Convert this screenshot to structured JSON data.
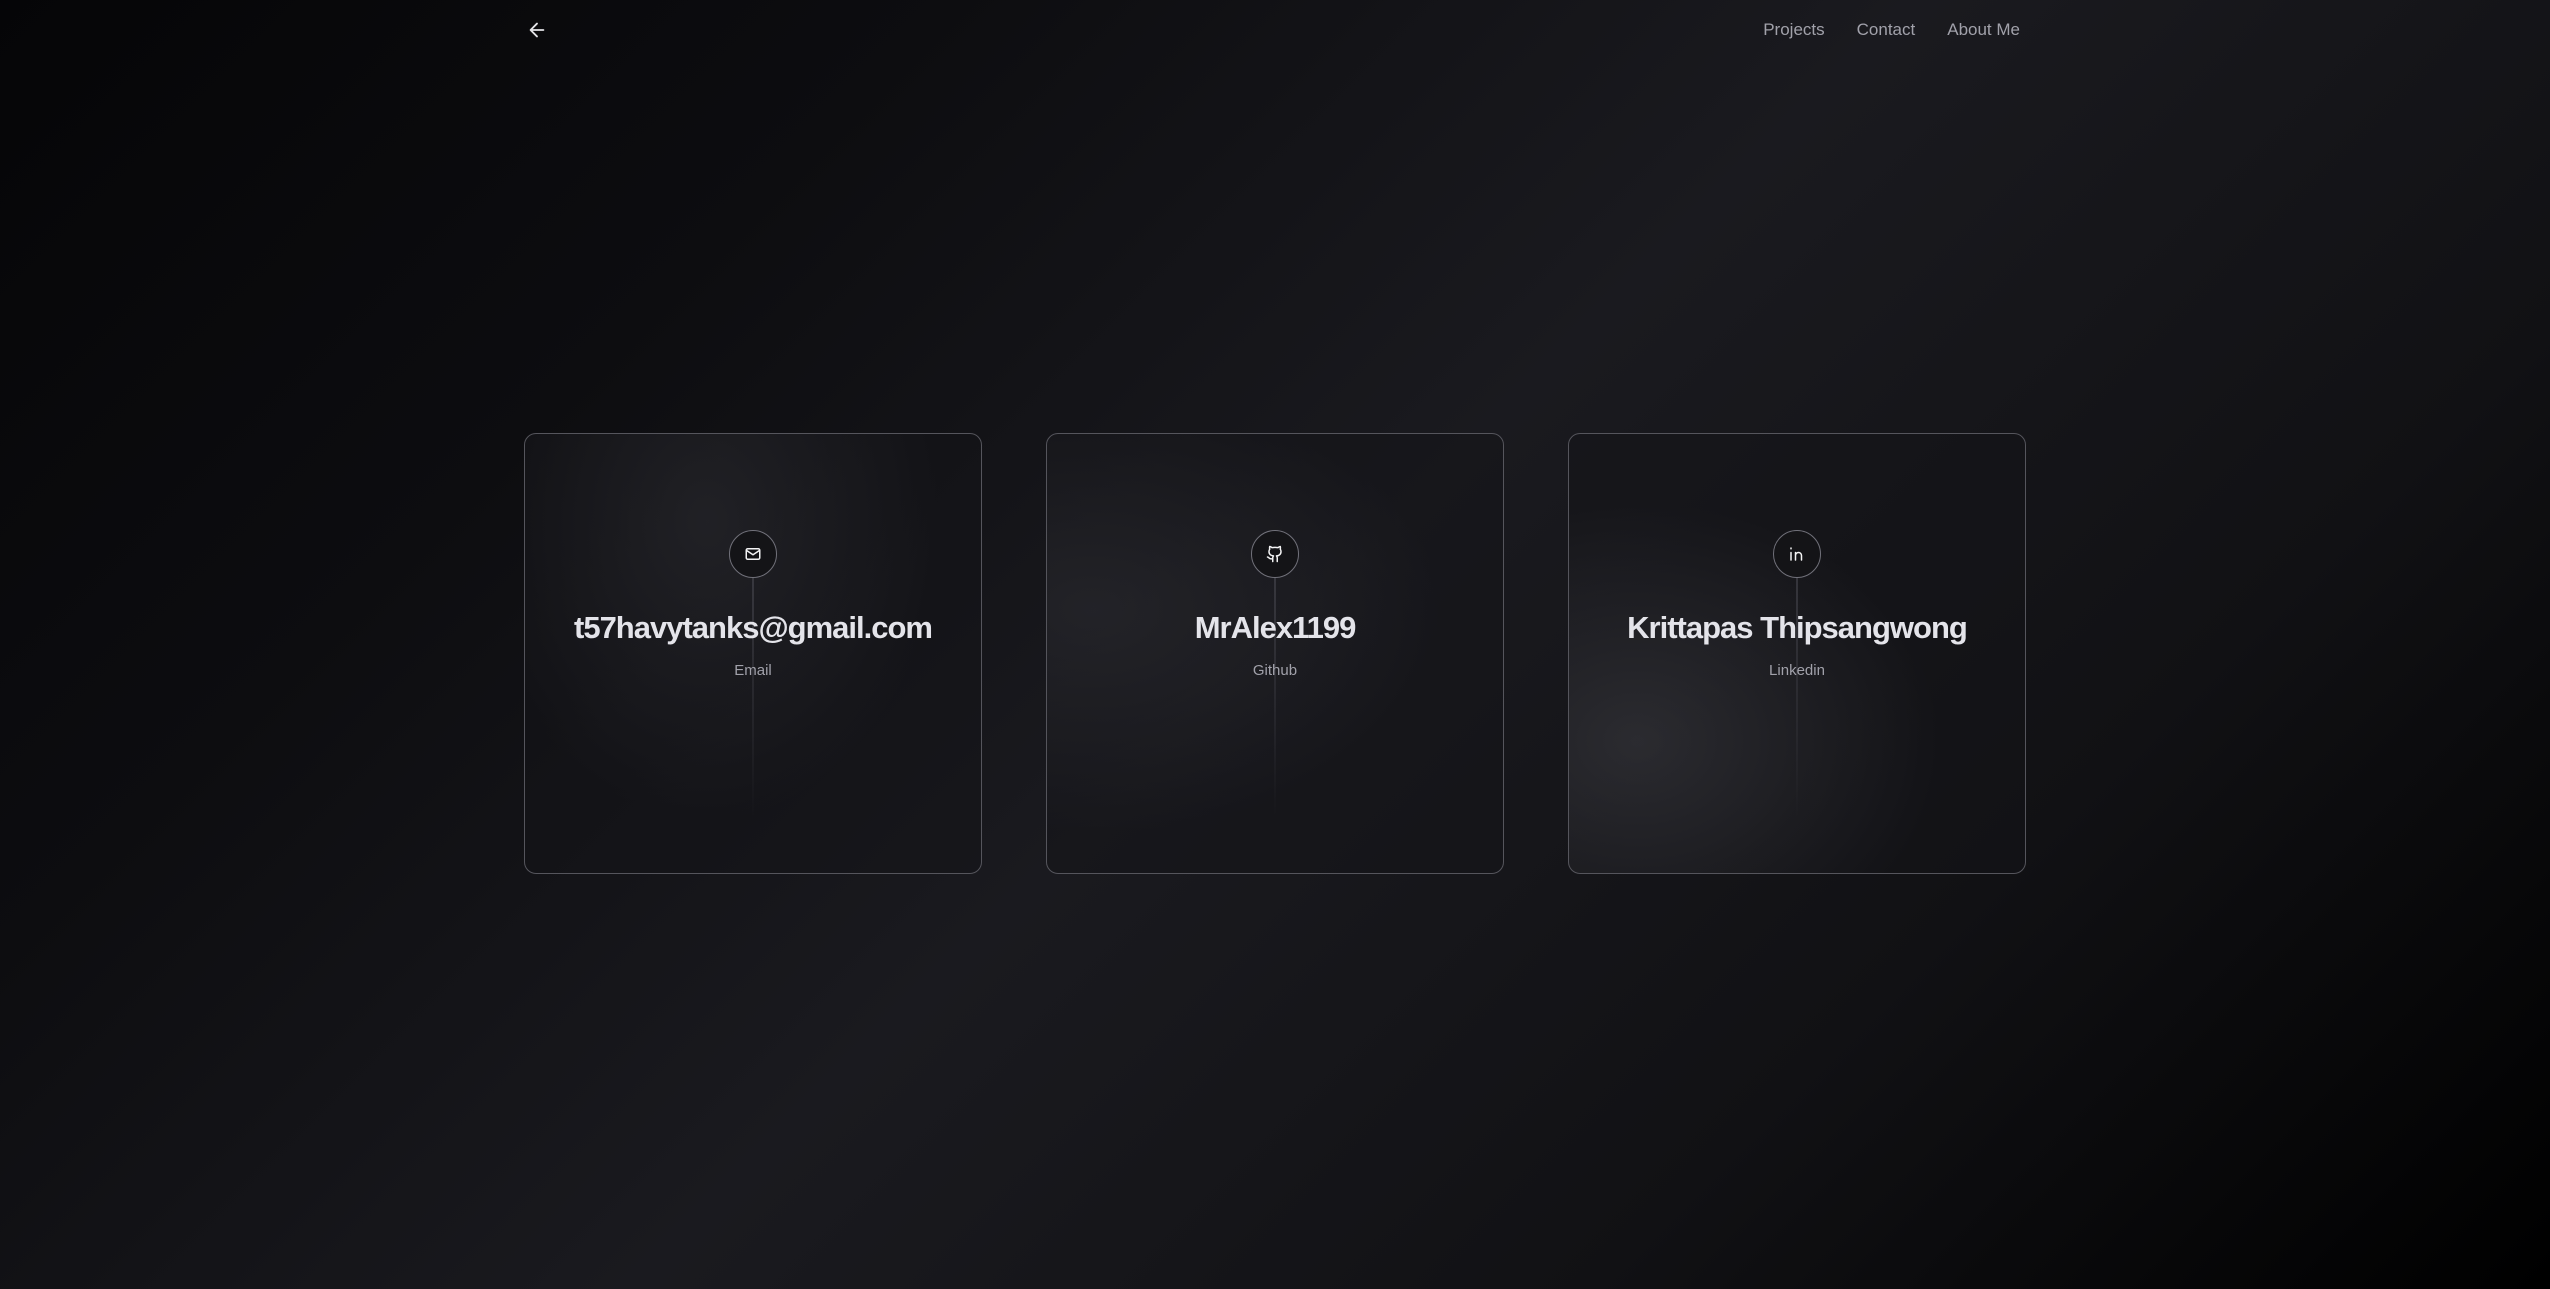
{
  "nav": {
    "back_icon": "arrow-left-icon",
    "items": [
      {
        "label": "Projects"
      },
      {
        "label": "Contact"
      },
      {
        "label": "About Me"
      }
    ]
  },
  "cards": [
    {
      "title": "t57havytanks@gmail.com",
      "label": "Email",
      "icon": "mail-icon"
    },
    {
      "title": "MrAlex1199",
      "label": "Github",
      "icon": "github-icon"
    },
    {
      "title": "Krittapas Thipsangwong",
      "label": "Linkedin",
      "icon": "linkedin-icon"
    }
  ]
}
